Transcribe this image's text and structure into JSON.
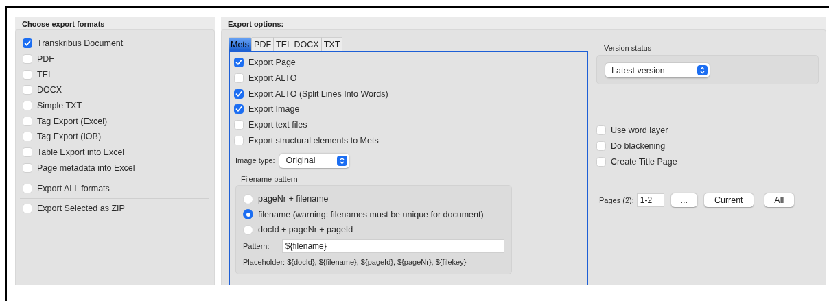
{
  "formats_panel": {
    "title": "Choose export formats",
    "formats": [
      {
        "label": "Transkribus Document",
        "checked": true
      },
      {
        "label": "PDF",
        "checked": false
      },
      {
        "label": "TEI",
        "checked": false
      },
      {
        "label": "DOCX",
        "checked": false
      },
      {
        "label": "Simple TXT",
        "checked": false
      },
      {
        "label": "Tag Export (Excel)",
        "checked": false
      },
      {
        "label": "Tag Export (IOB)",
        "checked": false
      },
      {
        "label": "Table Export into Excel",
        "checked": false
      },
      {
        "label": "Page metadata into Excel",
        "checked": false
      }
    ],
    "export_all": {
      "label": "Export ALL formats",
      "checked": false
    },
    "export_zip": {
      "label": "Export Selected as ZIP",
      "checked": false
    }
  },
  "options_panel": {
    "title": "Export options:",
    "tabs": [
      {
        "label": "Mets",
        "selected": true
      },
      {
        "label": "PDF",
        "selected": false
      },
      {
        "label": "TEI",
        "selected": false
      },
      {
        "label": "DOCX",
        "selected": false
      },
      {
        "label": "TXT",
        "selected": false
      }
    ],
    "mets_options": [
      {
        "label": "Export Page",
        "checked": true
      },
      {
        "label": "Export ALTO",
        "checked": false
      },
      {
        "label": "Export ALTO (Split Lines Into Words)",
        "checked": true
      },
      {
        "label": "Export Image",
        "checked": true
      },
      {
        "label": "Export text files",
        "checked": false
      },
      {
        "label": "Export structural elements to Mets",
        "checked": false
      }
    ],
    "image_type": {
      "label": "Image type:",
      "value": "Original"
    },
    "filename_pattern": {
      "title": "Filename pattern",
      "options": [
        {
          "label": "pageNr + filename",
          "selected": false
        },
        {
          "label": "filename (warning: filenames must be unique for document)",
          "selected": true
        },
        {
          "label": "docId + pageNr + pageId",
          "selected": false
        }
      ],
      "pattern": {
        "label": "Pattern:",
        "value": "${filename}"
      },
      "variables_note": "Placeholder: ${docId}, ${filename}, ${pageId}, ${pageNr}, ${filekey}"
    }
  },
  "version_status": {
    "label": "Version status",
    "value": "Latest version"
  },
  "extra_options": [
    {
      "label": "Use word layer",
      "checked": false
    },
    {
      "label": "Do blackening",
      "checked": false
    },
    {
      "label": "Create Title Page",
      "checked": false
    }
  ],
  "pages": {
    "label": "Pages (2):",
    "value": "1-2",
    "buttons": [
      "...",
      "Current",
      "All"
    ]
  }
}
